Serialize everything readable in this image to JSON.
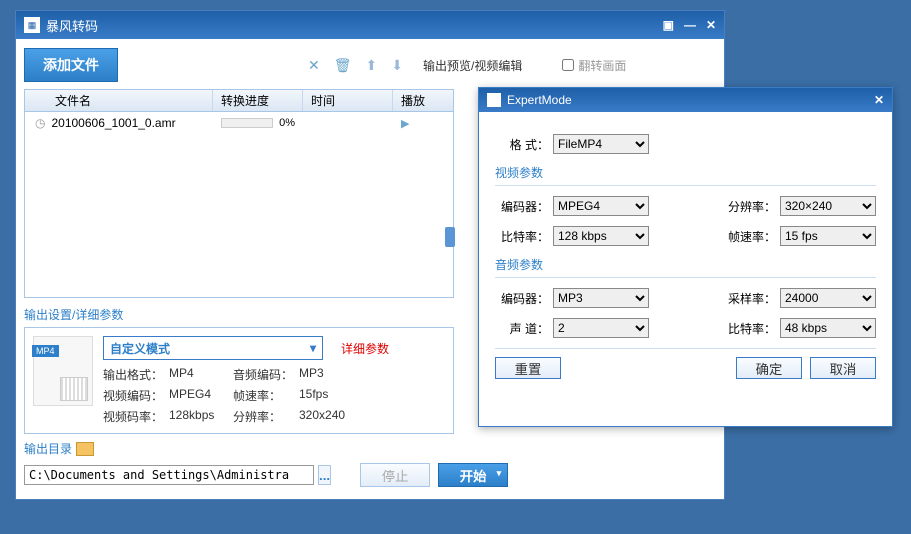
{
  "main": {
    "title": "暴风转码",
    "add_file": "添加文件",
    "preview_label": "输出预览/视频编辑",
    "flip_label": "翻转画面",
    "table": {
      "headers": {
        "filename": "文件名",
        "progress": "转换进度",
        "time": "时间",
        "play": "播放"
      },
      "rows": [
        {
          "name": "20100606_1001_0.amr",
          "progress_pct": "0%"
        }
      ]
    },
    "settings_label": "输出设置/详细参数",
    "thumb_badge": "MP4",
    "mode": "自定义模式",
    "detail_link": "详细参数",
    "params": {
      "out_fmt_l": "输出格式：",
      "out_fmt_v": "MP4",
      "audio_enc_l": "音频编码：",
      "audio_enc_v": "MP3",
      "video_enc_l": "视频编码：",
      "video_enc_v": "MPEG4",
      "fps_l": "帧速率：",
      "fps_v": "15fps",
      "bitrate_l": "视频码率：",
      "bitrate_v": "128kbps",
      "res_l": "分辨率：",
      "res_v": "320x240"
    },
    "out_dir_label": "输出目录",
    "out_path": "C:\\Documents and Settings\\Administra",
    "browse": "...",
    "stop": "停止",
    "start": "开始"
  },
  "expert": {
    "title": "ExpertMode",
    "format_l": "格  式：",
    "format_v": "FileMP4",
    "video_section": "视频参数",
    "encoder_l": "编码器：",
    "v_encoder_v": "MPEG4",
    "res_l": "分辨率：",
    "res_v": "320×240",
    "bitrate_l": "比特率：",
    "v_bitrate_v": "128 kbps",
    "fps_l": "帧速率：",
    "fps_v": "15 fps",
    "audio_section": "音频参数",
    "a_encoder_v": "MP3",
    "sample_l": "采样率：",
    "sample_v": "24000",
    "channel_l": "声  道：",
    "channel_v": "2",
    "a_bitrate_v": "48 kbps",
    "reset": "重置",
    "ok": "确定",
    "cancel": "取消"
  }
}
